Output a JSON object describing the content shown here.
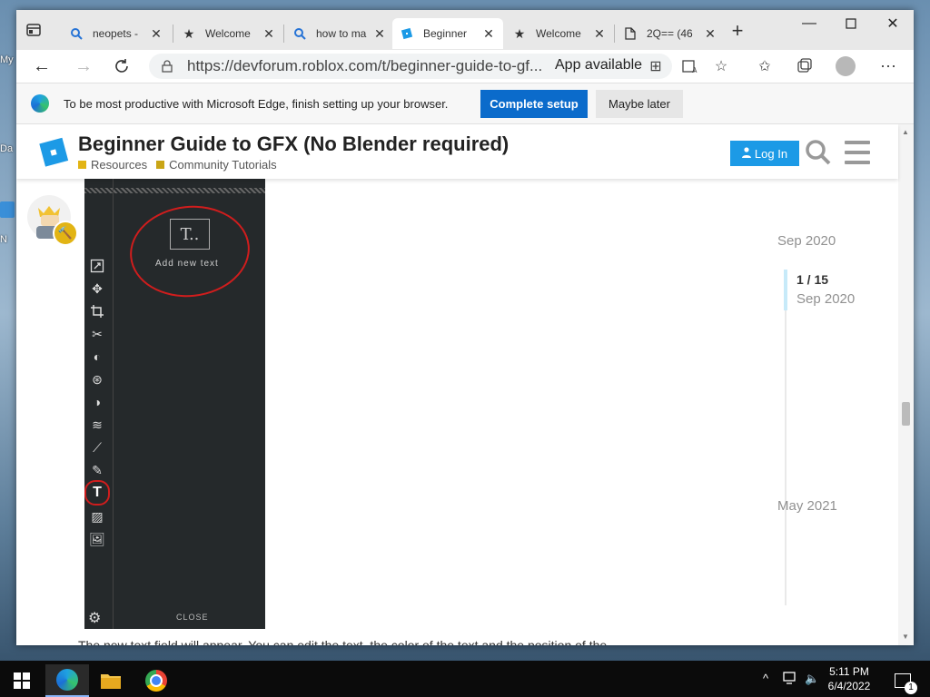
{
  "desktop": {
    "label_1": "My",
    "label_2": "Da",
    "label_3": "N"
  },
  "browser": {
    "tabs": [
      {
        "title": "neopets -",
        "icon": "search-icon",
        "active": false
      },
      {
        "title": "Welcome",
        "icon": "star-icon",
        "active": false
      },
      {
        "title": "how to ma",
        "icon": "search-icon",
        "active": false
      },
      {
        "title": "Beginner",
        "icon": "devforum-icon",
        "active": true
      },
      {
        "title": "Welcome",
        "icon": "star-icon",
        "active": false
      },
      {
        "title": "2Q== (46",
        "icon": "document-icon",
        "active": false
      }
    ],
    "new_tab": "+",
    "url": "https://devforum.roblox.com/t/beginner-guide-to-gf...",
    "app_available": "App available",
    "accent": "#0b6bcb"
  },
  "infobar": {
    "message": "To be most productive with Microsoft Edge, finish setting up your browser.",
    "primary_button": "Complete setup",
    "secondary_button": "Maybe later"
  },
  "topic": {
    "title": "Beginner Guide to GFX (No Blender required)",
    "categories": [
      {
        "name": "Resources",
        "color": "#e2b414"
      },
      {
        "name": "Community Tutorials",
        "color": "#c9a516"
      }
    ],
    "login": "Log In",
    "login_color": "#1c9ae6"
  },
  "embed": {
    "add_text_glyph": "T..",
    "add_text_label": "Add new text",
    "close_label": "CLOSE",
    "tools": [
      "resize",
      "move",
      "crop",
      "cut",
      "exposure",
      "dots",
      "vignette",
      "waves",
      "pick",
      "brush",
      "text",
      "texture",
      "image"
    ],
    "selected_tool": "text"
  },
  "timeline": {
    "top_date": "Sep 2020",
    "position": "1 / 15",
    "position_date": "Sep 2020",
    "bottom_date": "May 2021"
  },
  "post": {
    "partial_line": "The new text field will appear. You can edit the text, the color of the text and the position of the"
  },
  "taskbar": {
    "time": "5:11 PM",
    "date": "6/4/2022",
    "notification_count": "1"
  }
}
